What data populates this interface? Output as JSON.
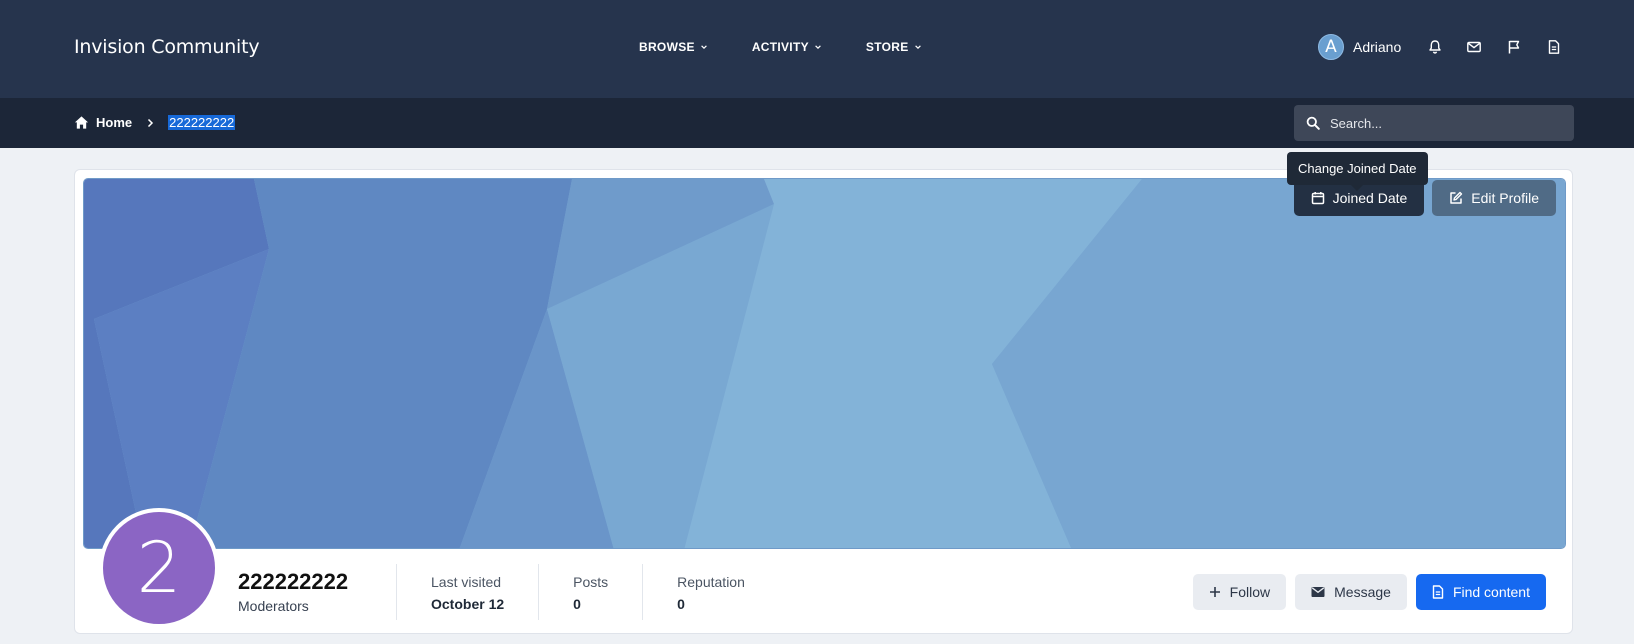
{
  "header": {
    "brand": "Invision Community",
    "nav": [
      {
        "label": "BROWSE"
      },
      {
        "label": "ACTIVITY"
      },
      {
        "label": "STORE"
      }
    ],
    "user": {
      "initial": "A",
      "name": "Adriano"
    }
  },
  "breadcrumb": {
    "home": "Home",
    "current": "222222222"
  },
  "search": {
    "placeholder": "Search..."
  },
  "cover": {
    "tooltip": "Change Joined Date",
    "joined_date_label": "Joined Date",
    "edit_profile_label": "Edit Profile"
  },
  "profile": {
    "avatar_initial": "2",
    "name": "222222222",
    "group": "Moderators",
    "stats": [
      {
        "label": "Last visited",
        "value": "October 12"
      },
      {
        "label": "Posts",
        "value": "0"
      },
      {
        "label": "Reputation",
        "value": "0"
      }
    ],
    "actions": {
      "follow": "Follow",
      "message": "Message",
      "find_content": "Find content"
    }
  },
  "colors": {
    "header_bg": "#26344d",
    "subbar_bg": "#1c2638",
    "accent": "#1669f0",
    "avatar_bg": "#8b65c4"
  }
}
